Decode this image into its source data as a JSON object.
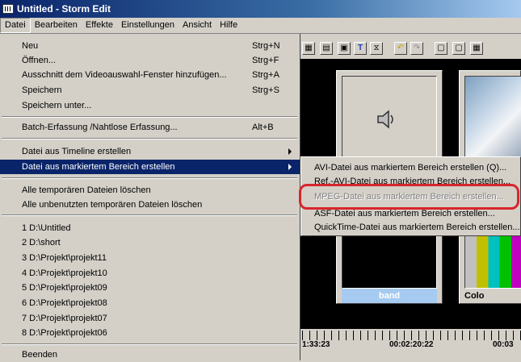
{
  "window": {
    "title": "Untitled - Storm Edit"
  },
  "menubar": [
    "Datei",
    "Bearbeiten",
    "Effekte",
    "Einstellungen",
    "Ansicht",
    "Hilfe"
  ],
  "menu": {
    "items": [
      {
        "label": "Neu",
        "accel": "Strg+N"
      },
      {
        "label": "Öffnen...",
        "accel": "Strg+F"
      },
      {
        "label": "Ausschnitt dem Videoauswahl-Fenster hinzufügen...",
        "accel": "Strg+A"
      },
      {
        "label": "Speichern",
        "accel": "Strg+S"
      },
      {
        "label": "Speichern unter...",
        "accel": ""
      },
      {
        "label": "Batch-Erfassung /Nahtlose Erfassung...",
        "accel": "Alt+B"
      },
      {
        "label": "Datei aus Timeline erstellen",
        "accel": ""
      },
      {
        "label": "Datei aus markiertem Bereich erstellen",
        "accel": ""
      },
      {
        "label": "Alle temporären Dateien löschen",
        "accel": ""
      },
      {
        "label": "Alle unbenutzten temporären Dateien löschen",
        "accel": ""
      },
      {
        "label": "1 D:\\Untitled",
        "accel": ""
      },
      {
        "label": "2 D:\\short",
        "accel": ""
      },
      {
        "label": "3 D:\\Projekt\\projekt11",
        "accel": ""
      },
      {
        "label": "4 D:\\Projekt\\projekt10",
        "accel": ""
      },
      {
        "label": "5 D:\\Projekt\\projekt09",
        "accel": ""
      },
      {
        "label": "6 D:\\Projekt\\projekt08",
        "accel": ""
      },
      {
        "label": "7 D:\\Projekt\\projekt07",
        "accel": ""
      },
      {
        "label": "8 D:\\Projekt\\projekt06",
        "accel": ""
      },
      {
        "label": "Beenden",
        "accel": ""
      }
    ]
  },
  "submenu": [
    {
      "label": "AVI-Datei aus markiertem Bereich erstellen (Q)...",
      "enabled": true
    },
    {
      "label": "Ref.-AVI-Datei aus markiertem Bereich erstellen...",
      "enabled": true
    },
    {
      "label": "MPEG-Datei aus markiertem Bereich erstellen...",
      "enabled": false
    },
    {
      "label": "ASF-Datei aus markiertem Bereich erstellen...",
      "enabled": true
    },
    {
      "label": "QuickTime-Datei aus markiertem Bereich erstellen...",
      "enabled": true
    }
  ],
  "thumbnails": [
    {
      "label": "band"
    },
    {
      "label": "Colo"
    }
  ],
  "timeline": {
    "times": [
      "1:33:23",
      "00:02:20:22",
      "00:03"
    ]
  },
  "colors": {
    "highlight": "#0a246a",
    "annotation_red": "#d9252b"
  },
  "icons": [
    "speaker-icon"
  ]
}
